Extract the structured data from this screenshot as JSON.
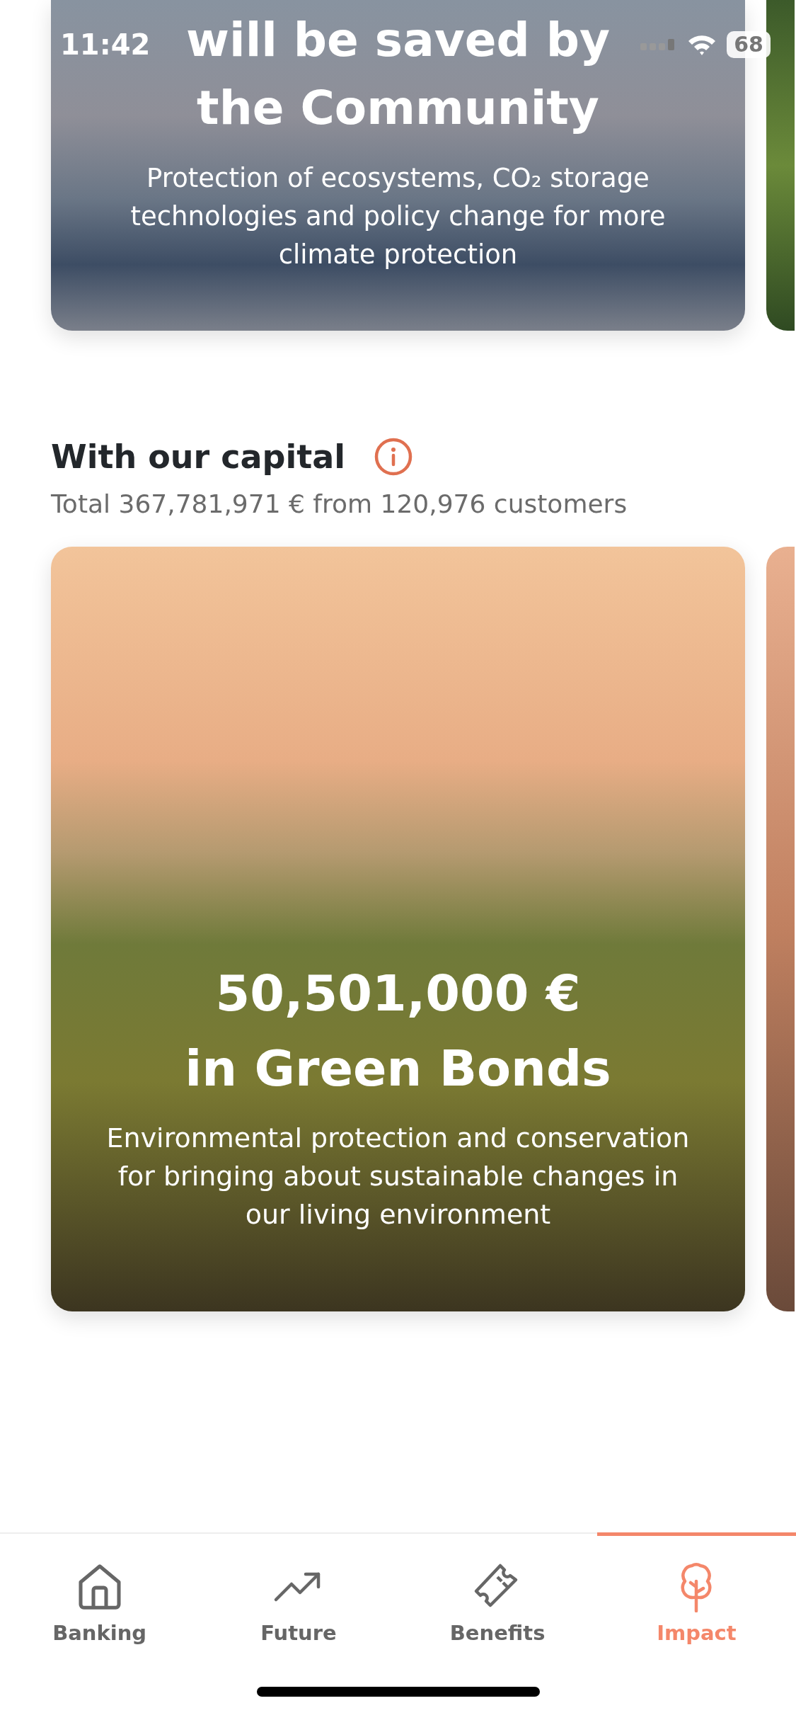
{
  "status_bar": {
    "time": "11:42",
    "battery": "68"
  },
  "hero_card": {
    "title_lines": [
      "will be saved by",
      "the Community"
    ],
    "text": "Protection of ecosystems, CO₂ storage technologies and policy change for more climate protection"
  },
  "capital_section": {
    "heading": "With our capital",
    "summary": "Total 367,781,971 € from 120,976 customers"
  },
  "capital_card": {
    "amount": "50,501,000 €",
    "title": "in Green Bonds",
    "text": "Environmental protection and conservation for bringing about sustainable changes in our living environment"
  },
  "tab_bar": [
    {
      "label": "Banking",
      "selected": false
    },
    {
      "label": "Future",
      "selected": false
    },
    {
      "label": "Benefits",
      "selected": false
    },
    {
      "label": "Impact",
      "selected": true
    }
  ]
}
